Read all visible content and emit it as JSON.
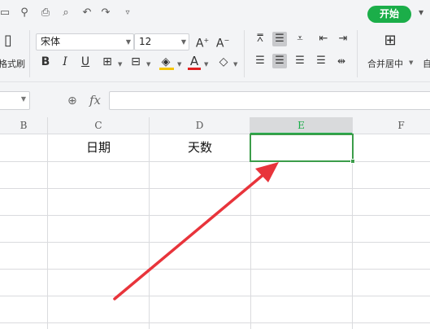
{
  "quick_access": {
    "icons": [
      "save-icon",
      "search-icon",
      "print-icon",
      "print-preview-icon",
      "undo-icon",
      "redo-icon",
      "customize-icon"
    ],
    "start_tab_label": "开始"
  },
  "ribbon": {
    "format_painter_label": "格式刷",
    "font_name": "宋体",
    "font_size": "12",
    "merge_center_label": "合并居中",
    "autowrap_label_partial": "自"
  },
  "formula_bar": {
    "fx_label": "fx",
    "name_box_value": "",
    "formula_value": ""
  },
  "sheet": {
    "columns": [
      "B",
      "C",
      "D",
      "E",
      "F"
    ],
    "selected_column": "E",
    "cells": {
      "C1": "日期",
      "D1": "天数",
      "E1": ""
    }
  },
  "colors": {
    "accent_green": "#1bae49",
    "selection_border": "#3c9d4a",
    "annotation_arrow": "#e8343b"
  }
}
